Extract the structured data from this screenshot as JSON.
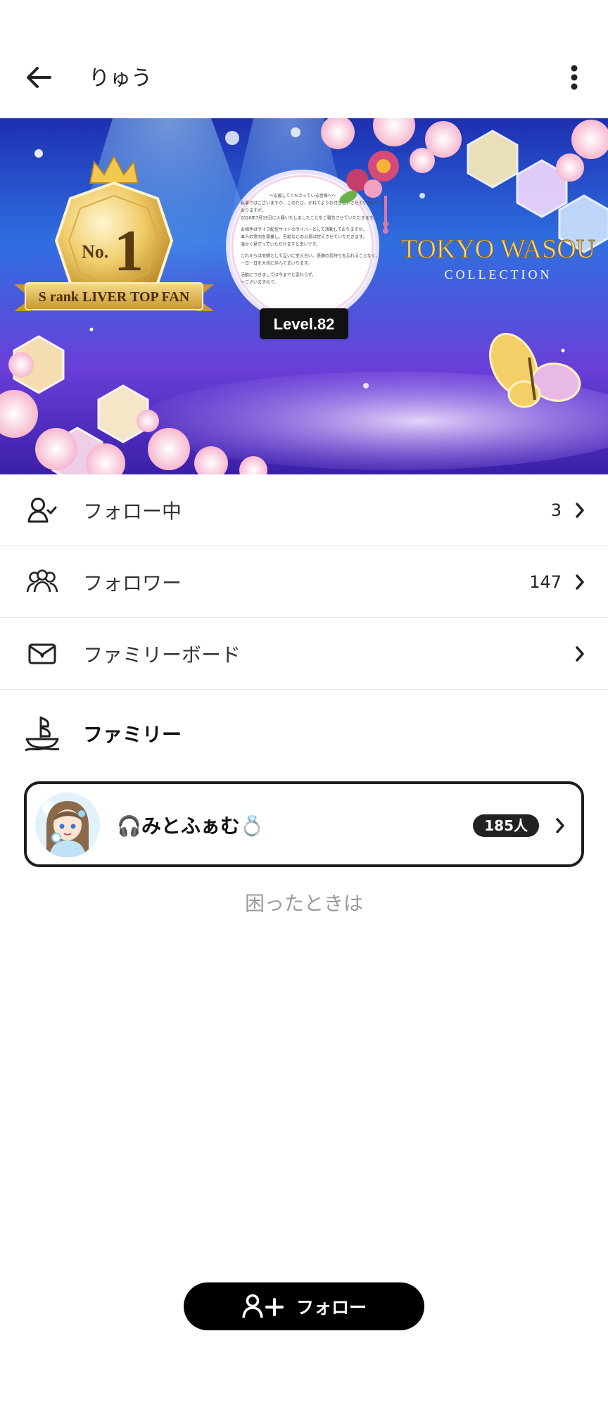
{
  "header": {
    "title": "りゅう"
  },
  "banner": {
    "rank_prefix": "No.",
    "rank_number": "1",
    "ribbon_text": "S rank LIVER TOP FAN",
    "collection_title": "TOKYO WASOU",
    "collection_subtitle": "COLLECTION",
    "level_badge": "Level.82",
    "letter_lines": [
      "〜応援してくださっている皆様へ〜",
      "私事ではございますが、このたび、かねてよりお付き合いさせていただいて",
      "おりますが、",
      "2026年7月19日に入籍いたしましたことをご報告させていただきます。",
      "",
      "お相手はライブ配信サイトのライバーとして活動しておりますが、",
      "本人の意向を尊重し、名前などの公表は控えさせていただきます。",
      "温かく見守っていただけますと幸いです。",
      "",
      "これからは夫婦として互いに支え合い、感謝の気持ちを忘れることなく、",
      "一日一日を大切に歩んでまいります。",
      "",
      "活動につきましては今までと変わらず、",
      "〜ございますので、"
    ]
  },
  "menu": [
    {
      "label": "フォロー中",
      "count": "3",
      "icon": "person-check-icon"
    },
    {
      "label": "フォロワー",
      "count": "147",
      "icon": "people-group-icon"
    },
    {
      "label": "ファミリーボード",
      "count": "",
      "icon": "heart-envelope-icon"
    }
  ],
  "family": {
    "section_title": "ファミリー",
    "section_icon": "ship-icon",
    "card": {
      "name": "🎧みとふぁむ💍",
      "members": "185人"
    }
  },
  "help_link": "困ったときは",
  "follow_button": {
    "label": "フォロー",
    "icon": "add-person-icon"
  },
  "colors": {
    "accent": "#000000",
    "banner_sky": "#3b3fd8",
    "gold": "#d9a93c",
    "divider": "#e3e3e3"
  }
}
